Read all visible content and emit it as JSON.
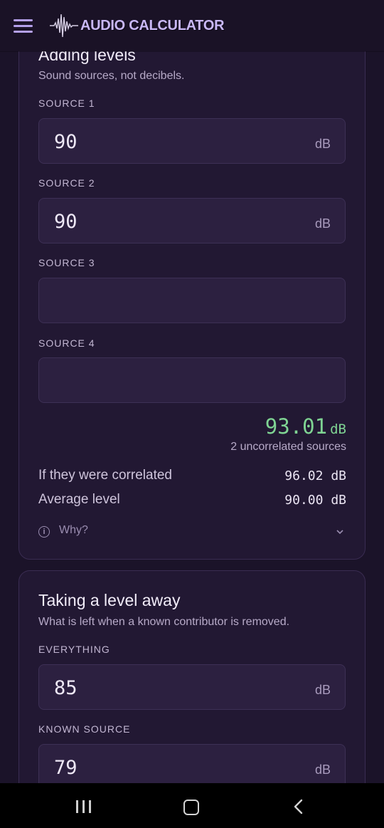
{
  "app": {
    "title": "AUDIO CALCULATOR"
  },
  "icons": {
    "menu": "hamburger-menu-icon",
    "logo": "waveform-logo-icon",
    "info": "info-icon",
    "expand": "chevron-down-icon"
  },
  "colors": {
    "accent": "#b4a0ea",
    "result": "#7fd493",
    "background": "#1b1329",
    "card": "#221833"
  },
  "adding": {
    "title": "Adding levels",
    "subtitle": "Sound sources, not decibels.",
    "fields": [
      {
        "label": "SOURCE 1",
        "value": "90",
        "unit": "dB"
      },
      {
        "label": "SOURCE 2",
        "value": "90",
        "unit": "dB"
      },
      {
        "label": "SOURCE 3",
        "value": "",
        "unit": ""
      },
      {
        "label": "SOURCE 4",
        "value": "",
        "unit": ""
      }
    ],
    "result_value": "93.01",
    "result_unit": "dB",
    "result_note": "2 uncorrelated sources",
    "rows": [
      {
        "label": "If they were correlated",
        "value": "96.02 dB"
      },
      {
        "label": "Average level",
        "value": "90.00 dB"
      }
    ],
    "why_label": "Why?"
  },
  "removing": {
    "title": "Taking a level away",
    "subtitle": "What is left when a known contributor is removed.",
    "fields": [
      {
        "label": "EVERYTHING",
        "value": "85",
        "unit": "dB"
      },
      {
        "label": "KNOWN SOURCE",
        "value": "79",
        "unit": "dB"
      }
    ]
  },
  "navbar": {
    "recents": "recents-icon",
    "home": "home-icon",
    "back": "back-icon"
  }
}
